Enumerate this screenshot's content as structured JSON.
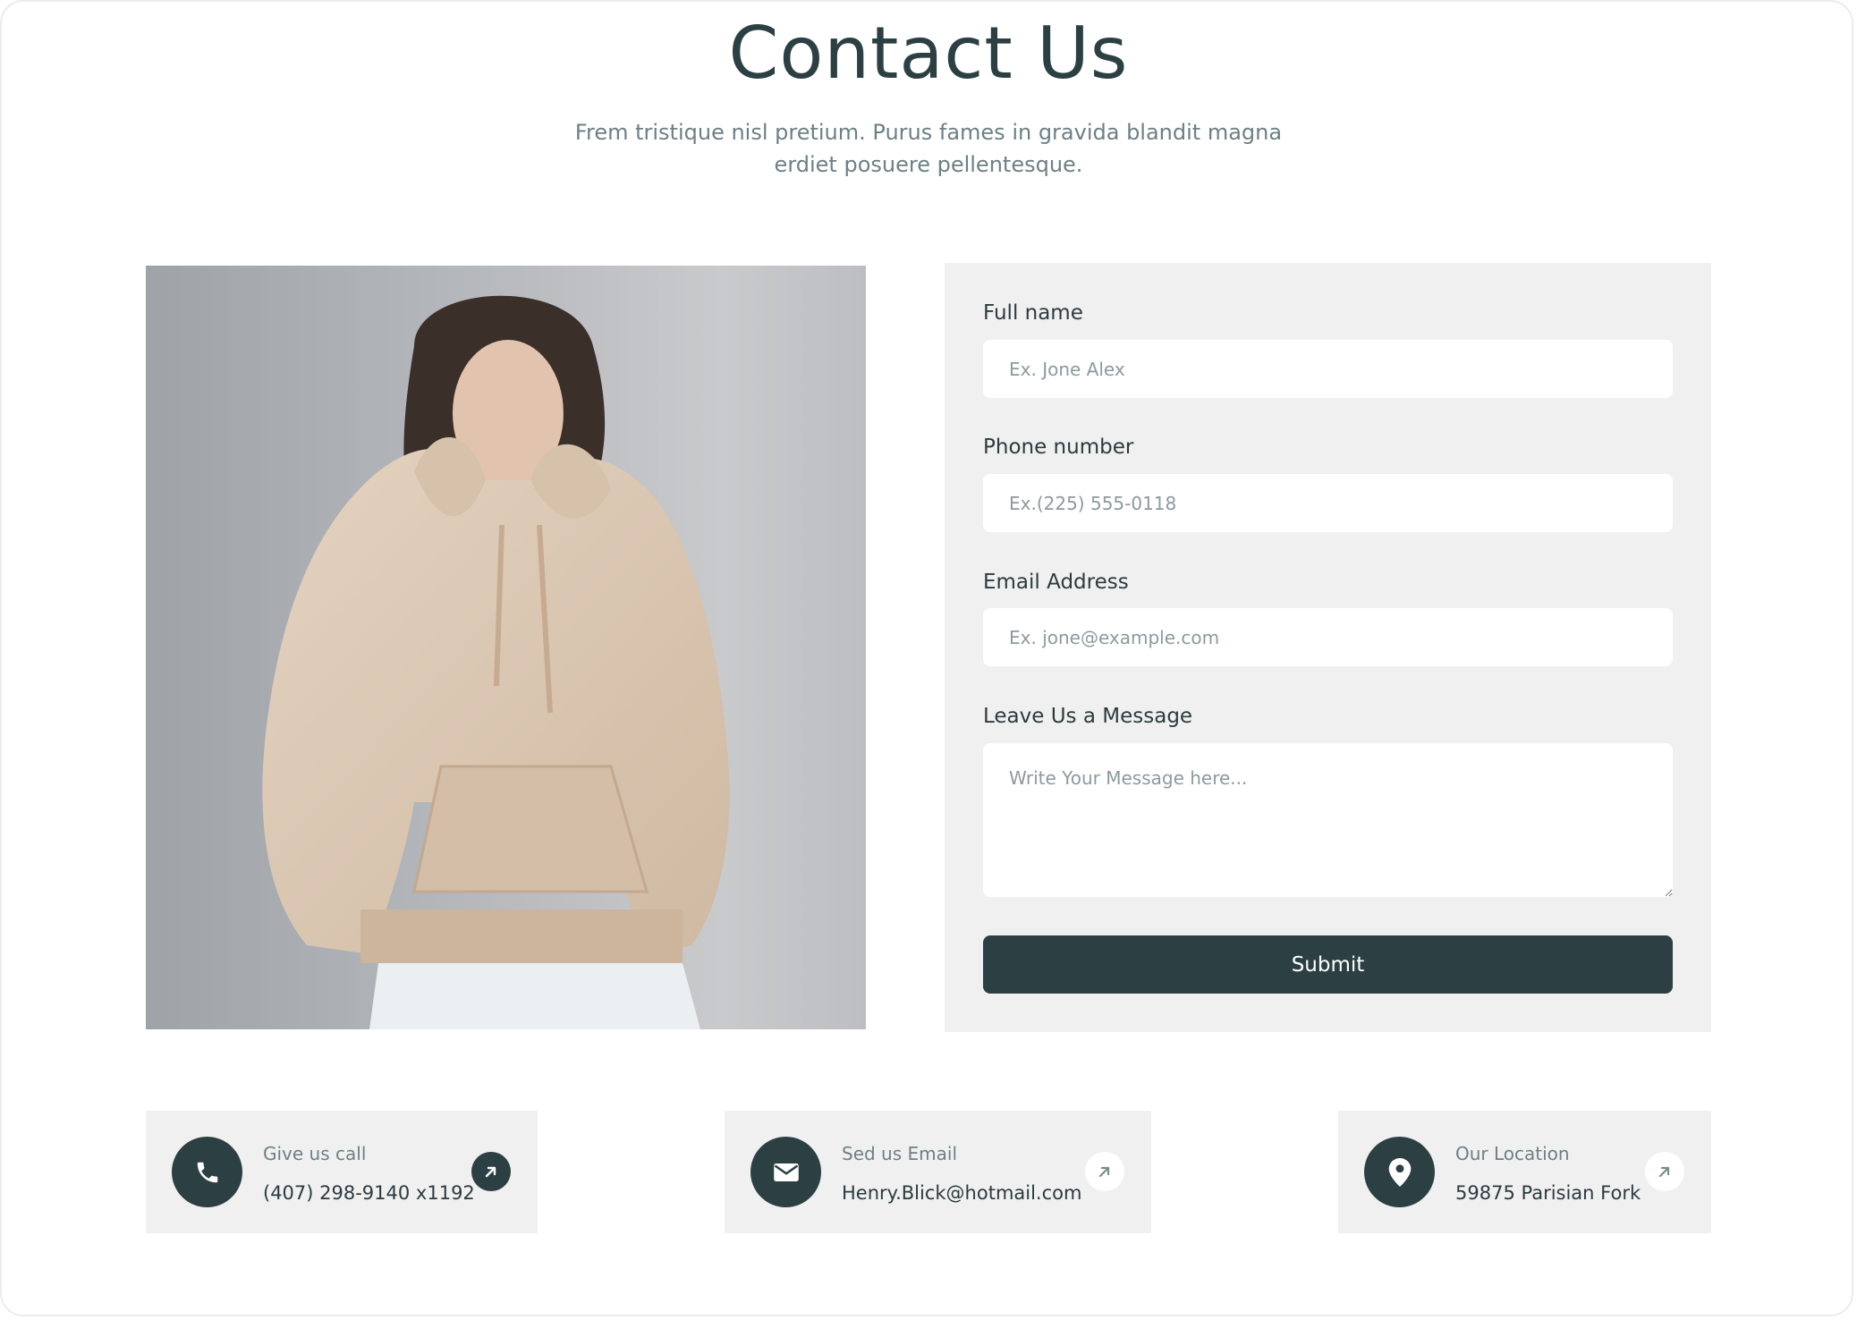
{
  "header": {
    "title": "Contact Us",
    "subtitle": "Frem tristique nisl pretium. Purus fames in gravida blandit magna erdiet posuere pellentesque."
  },
  "form": {
    "full_name": {
      "label": "Full name",
      "placeholder": "Ex. Jone Alex",
      "value": ""
    },
    "phone": {
      "label": "Phone number",
      "placeholder": "Ex.(225) 555-0118",
      "value": ""
    },
    "email": {
      "label": "Email Address",
      "placeholder": "Ex. jone@example.com",
      "value": ""
    },
    "message": {
      "label": "Leave Us a Message",
      "placeholder": "Write Your Message here...",
      "value": ""
    },
    "submit_label": "Submit"
  },
  "contacts": [
    {
      "caption": "Give us call",
      "value": "(407) 298-9140 x1192",
      "icon": "phone-icon",
      "arrow": "dark"
    },
    {
      "caption": "Sed us Email",
      "value": "Henry.Blick@hotmail.com",
      "icon": "mail-icon",
      "arrow": "light"
    },
    {
      "caption": "Our Location",
      "value": "59875 Parisian Fork",
      "icon": "location-pin-icon",
      "arrow": "light"
    }
  ],
  "colors": {
    "primary": "#2c4044",
    "panel": "#f0f0f0",
    "muted_text": "#6d8086",
    "placeholder": "#8c9a9e"
  }
}
